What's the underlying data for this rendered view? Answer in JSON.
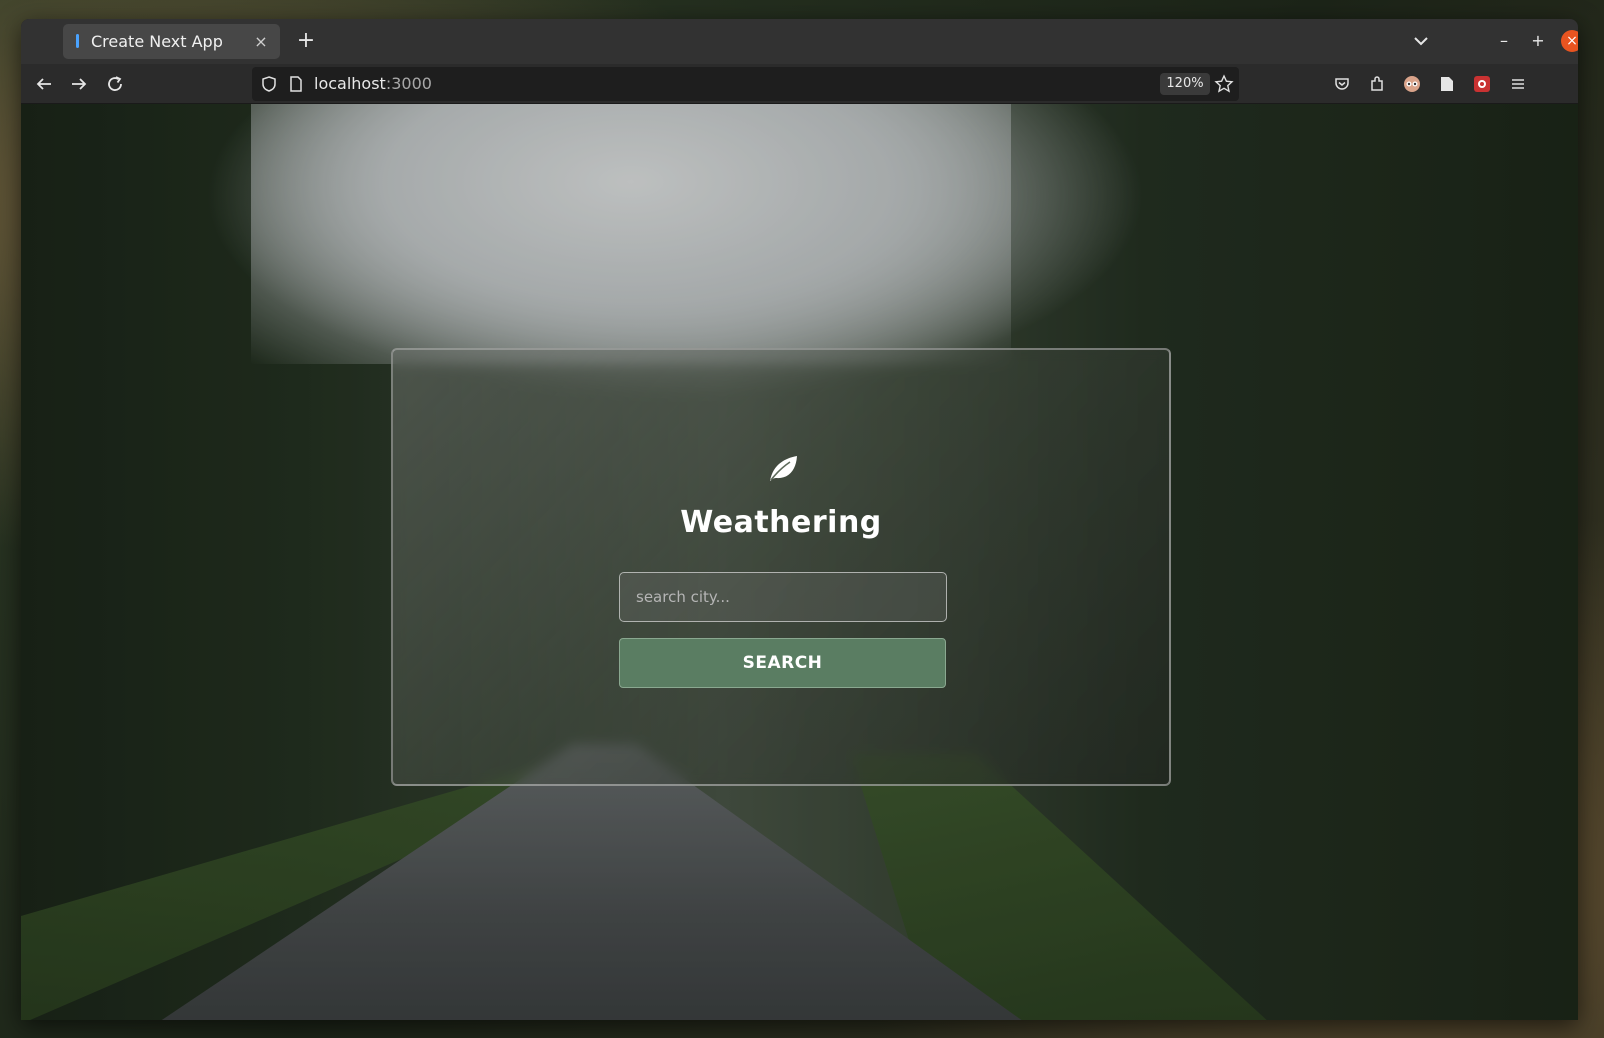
{
  "browser": {
    "tab_title": "Create Next App",
    "tab_close": "×",
    "new_tab": "+",
    "url_host": "localhost",
    "url_port": ":3000",
    "zoom": "120%"
  },
  "window_controls": {
    "min": "–",
    "max": "+",
    "close": "×"
  },
  "app": {
    "brand": "Weathering",
    "search_placeholder": "search city...",
    "search_value": "",
    "search_button": "SEARCH"
  },
  "colors": {
    "accent_button": "#5a7d62",
    "close_button": "#e95420"
  }
}
